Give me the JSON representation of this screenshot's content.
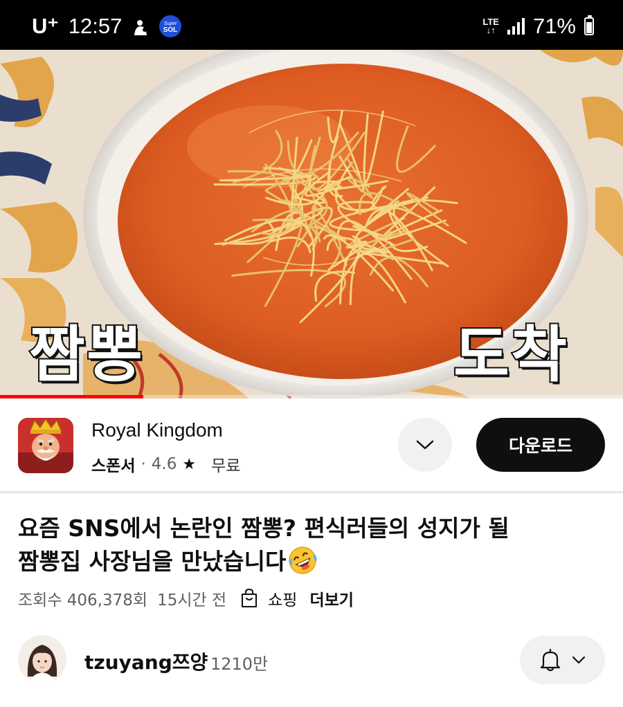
{
  "status_bar": {
    "carrier": "U⁺",
    "time": "12:57",
    "network": "LTE",
    "battery": "71%",
    "battery_level": 0.71,
    "icons": [
      "bixby-figure-icon",
      "supersol-app-icon",
      "lte-icon",
      "signal-bars-icon",
      "battery-icon"
    ],
    "supersol_text": "Super SOL"
  },
  "video": {
    "caption_left": "짬뽕",
    "caption_right": "도착",
    "progress": 0.23,
    "progress_color": "#ff0000"
  },
  "ad": {
    "app_name": "Royal Kingdom",
    "sponsor_label": "스폰서",
    "separator": "·",
    "rating": "4.6",
    "rating_icon": "star-icon",
    "price": "무료",
    "expand_icon": "chevron-down-icon",
    "download_label": "다운로드"
  },
  "video_info": {
    "title_line1": "요즘 SNS에서 논란인 짬뽕? 편식러들의 성지가 될",
    "title_line2": "짬뽕집 사장님을 만났습니다",
    "title_emoji": "rolling-on-floor-laughing-emoji",
    "views": "조회수 406,378회",
    "age": "15시간 전",
    "shopping_icon": "shopping-bag-icon",
    "shopping_label": "쇼핑",
    "more_label": "더보기"
  },
  "channel": {
    "name": "tzuyang쯔양",
    "subscribers": "1210만",
    "bell_icon": "bell-icon",
    "dropdown_icon": "chevron-down-icon"
  },
  "colors": {
    "broth": "#e2622a",
    "primary_text": "#0f0f0f",
    "secondary_text": "#606060",
    "chip_bg": "#f1f1f1",
    "accent_red": "#ff0000"
  }
}
